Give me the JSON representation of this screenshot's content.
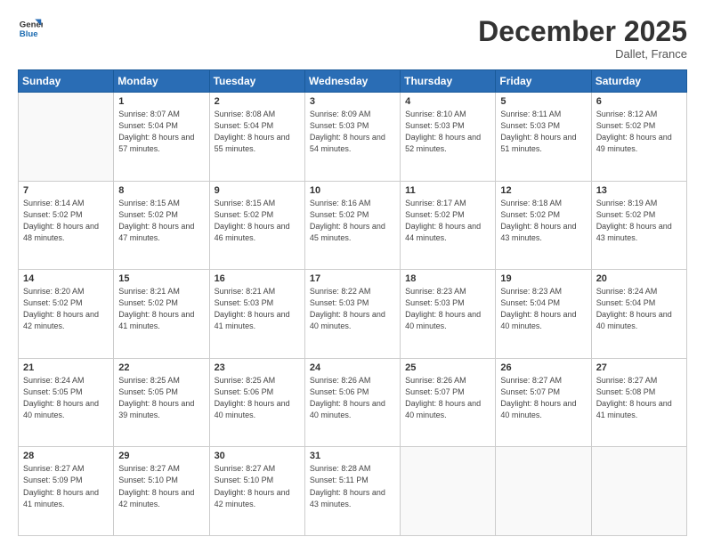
{
  "header": {
    "logo_line1": "General",
    "logo_line2": "Blue",
    "month": "December 2025",
    "location": "Dallet, France"
  },
  "weekdays": [
    "Sunday",
    "Monday",
    "Tuesday",
    "Wednesday",
    "Thursday",
    "Friday",
    "Saturday"
  ],
  "weeks": [
    [
      {
        "day": "",
        "sunrise": "",
        "sunset": "",
        "daylight": ""
      },
      {
        "day": "1",
        "sunrise": "Sunrise: 8:07 AM",
        "sunset": "Sunset: 5:04 PM",
        "daylight": "Daylight: 8 hours and 57 minutes."
      },
      {
        "day": "2",
        "sunrise": "Sunrise: 8:08 AM",
        "sunset": "Sunset: 5:04 PM",
        "daylight": "Daylight: 8 hours and 55 minutes."
      },
      {
        "day": "3",
        "sunrise": "Sunrise: 8:09 AM",
        "sunset": "Sunset: 5:03 PM",
        "daylight": "Daylight: 8 hours and 54 minutes."
      },
      {
        "day": "4",
        "sunrise": "Sunrise: 8:10 AM",
        "sunset": "Sunset: 5:03 PM",
        "daylight": "Daylight: 8 hours and 52 minutes."
      },
      {
        "day": "5",
        "sunrise": "Sunrise: 8:11 AM",
        "sunset": "Sunset: 5:03 PM",
        "daylight": "Daylight: 8 hours and 51 minutes."
      },
      {
        "day": "6",
        "sunrise": "Sunrise: 8:12 AM",
        "sunset": "Sunset: 5:02 PM",
        "daylight": "Daylight: 8 hours and 49 minutes."
      }
    ],
    [
      {
        "day": "7",
        "sunrise": "Sunrise: 8:14 AM",
        "sunset": "Sunset: 5:02 PM",
        "daylight": "Daylight: 8 hours and 48 minutes."
      },
      {
        "day": "8",
        "sunrise": "Sunrise: 8:15 AM",
        "sunset": "Sunset: 5:02 PM",
        "daylight": "Daylight: 8 hours and 47 minutes."
      },
      {
        "day": "9",
        "sunrise": "Sunrise: 8:15 AM",
        "sunset": "Sunset: 5:02 PM",
        "daylight": "Daylight: 8 hours and 46 minutes."
      },
      {
        "day": "10",
        "sunrise": "Sunrise: 8:16 AM",
        "sunset": "Sunset: 5:02 PM",
        "daylight": "Daylight: 8 hours and 45 minutes."
      },
      {
        "day": "11",
        "sunrise": "Sunrise: 8:17 AM",
        "sunset": "Sunset: 5:02 PM",
        "daylight": "Daylight: 8 hours and 44 minutes."
      },
      {
        "day": "12",
        "sunrise": "Sunrise: 8:18 AM",
        "sunset": "Sunset: 5:02 PM",
        "daylight": "Daylight: 8 hours and 43 minutes."
      },
      {
        "day": "13",
        "sunrise": "Sunrise: 8:19 AM",
        "sunset": "Sunset: 5:02 PM",
        "daylight": "Daylight: 8 hours and 43 minutes."
      }
    ],
    [
      {
        "day": "14",
        "sunrise": "Sunrise: 8:20 AM",
        "sunset": "Sunset: 5:02 PM",
        "daylight": "Daylight: 8 hours and 42 minutes."
      },
      {
        "day": "15",
        "sunrise": "Sunrise: 8:21 AM",
        "sunset": "Sunset: 5:02 PM",
        "daylight": "Daylight: 8 hours and 41 minutes."
      },
      {
        "day": "16",
        "sunrise": "Sunrise: 8:21 AM",
        "sunset": "Sunset: 5:03 PM",
        "daylight": "Daylight: 8 hours and 41 minutes."
      },
      {
        "day": "17",
        "sunrise": "Sunrise: 8:22 AM",
        "sunset": "Sunset: 5:03 PM",
        "daylight": "Daylight: 8 hours and 40 minutes."
      },
      {
        "day": "18",
        "sunrise": "Sunrise: 8:23 AM",
        "sunset": "Sunset: 5:03 PM",
        "daylight": "Daylight: 8 hours and 40 minutes."
      },
      {
        "day": "19",
        "sunrise": "Sunrise: 8:23 AM",
        "sunset": "Sunset: 5:04 PM",
        "daylight": "Daylight: 8 hours and 40 minutes."
      },
      {
        "day": "20",
        "sunrise": "Sunrise: 8:24 AM",
        "sunset": "Sunset: 5:04 PM",
        "daylight": "Daylight: 8 hours and 40 minutes."
      }
    ],
    [
      {
        "day": "21",
        "sunrise": "Sunrise: 8:24 AM",
        "sunset": "Sunset: 5:05 PM",
        "daylight": "Daylight: 8 hours and 40 minutes."
      },
      {
        "day": "22",
        "sunrise": "Sunrise: 8:25 AM",
        "sunset": "Sunset: 5:05 PM",
        "daylight": "Daylight: 8 hours and 39 minutes."
      },
      {
        "day": "23",
        "sunrise": "Sunrise: 8:25 AM",
        "sunset": "Sunset: 5:06 PM",
        "daylight": "Daylight: 8 hours and 40 minutes."
      },
      {
        "day": "24",
        "sunrise": "Sunrise: 8:26 AM",
        "sunset": "Sunset: 5:06 PM",
        "daylight": "Daylight: 8 hours and 40 minutes."
      },
      {
        "day": "25",
        "sunrise": "Sunrise: 8:26 AM",
        "sunset": "Sunset: 5:07 PM",
        "daylight": "Daylight: 8 hours and 40 minutes."
      },
      {
        "day": "26",
        "sunrise": "Sunrise: 8:27 AM",
        "sunset": "Sunset: 5:07 PM",
        "daylight": "Daylight: 8 hours and 40 minutes."
      },
      {
        "day": "27",
        "sunrise": "Sunrise: 8:27 AM",
        "sunset": "Sunset: 5:08 PM",
        "daylight": "Daylight: 8 hours and 41 minutes."
      }
    ],
    [
      {
        "day": "28",
        "sunrise": "Sunrise: 8:27 AM",
        "sunset": "Sunset: 5:09 PM",
        "daylight": "Daylight: 8 hours and 41 minutes."
      },
      {
        "day": "29",
        "sunrise": "Sunrise: 8:27 AM",
        "sunset": "Sunset: 5:10 PM",
        "daylight": "Daylight: 8 hours and 42 minutes."
      },
      {
        "day": "30",
        "sunrise": "Sunrise: 8:27 AM",
        "sunset": "Sunset: 5:10 PM",
        "daylight": "Daylight: 8 hours and 42 minutes."
      },
      {
        "day": "31",
        "sunrise": "Sunrise: 8:28 AM",
        "sunset": "Sunset: 5:11 PM",
        "daylight": "Daylight: 8 hours and 43 minutes."
      },
      {
        "day": "",
        "sunrise": "",
        "sunset": "",
        "daylight": ""
      },
      {
        "day": "",
        "sunrise": "",
        "sunset": "",
        "daylight": ""
      },
      {
        "day": "",
        "sunrise": "",
        "sunset": "",
        "daylight": ""
      }
    ]
  ]
}
